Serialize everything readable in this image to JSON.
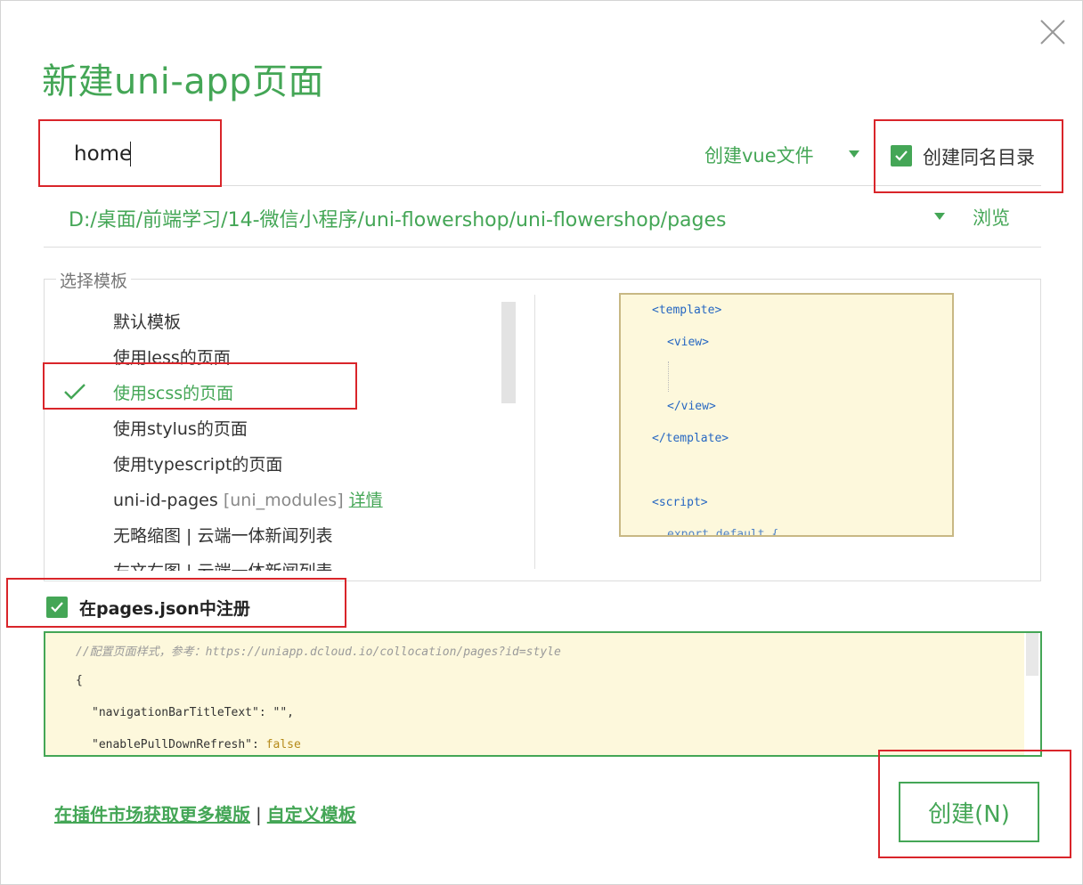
{
  "dialog": {
    "title": "新建uni-app页面",
    "close_icon": "close-icon"
  },
  "name_input": {
    "value": "home"
  },
  "file_type": {
    "label": "创建vue文件",
    "icon": "dropdown-triangle-icon"
  },
  "same_dir_checkbox": {
    "label": "创建同名目录",
    "checked": true
  },
  "path": {
    "value": "D:/桌面/前端学习/14-微信小程序/uni-flowershop/uni-flowershop/pages",
    "browse_label": "浏览"
  },
  "templates": {
    "legend": "选择模板",
    "items": [
      {
        "label": "默认模板"
      },
      {
        "label": "使用less的页面"
      },
      {
        "label": "使用scss的页面",
        "selected": true
      },
      {
        "label": "使用stylus的页面"
      },
      {
        "label": "使用typescript的页面"
      },
      {
        "label": "uni-id-pages",
        "sub": "[uni_modules]",
        "link": "详情"
      },
      {
        "label": "无略缩图 | 云端一体新闻列表"
      },
      {
        "label": "左文右图 | 云端一体新闻列表"
      }
    ]
  },
  "preview": {
    "lines": [
      "<template>",
      "<view>",
      "</view>",
      "</template>",
      "<script>",
      "export default {"
    ]
  },
  "register_checkbox": {
    "label": "在pages.json中注册",
    "checked": true
  },
  "pages_json": {
    "comment": "//配置页面样式，参考：https://uniapp.dcloud.io/collocation/pages?id=style",
    "open_brace": "{",
    "line1_key": "\"navigationBarTitleText\"",
    "line1_rest": ": \"\",",
    "line2_key": "\"enablePullDownRefresh\"",
    "line2_sep": ": ",
    "line2_value": "false"
  },
  "footer": {
    "market_link": "在插件市场获取更多模版",
    "separator": "|",
    "custom_link": "自定义模板"
  },
  "create_button": {
    "label": "创建(N)"
  },
  "colors": {
    "accent": "#44a656",
    "highlight_box": "#d9252a",
    "code_bg": "#fdf8dc"
  }
}
